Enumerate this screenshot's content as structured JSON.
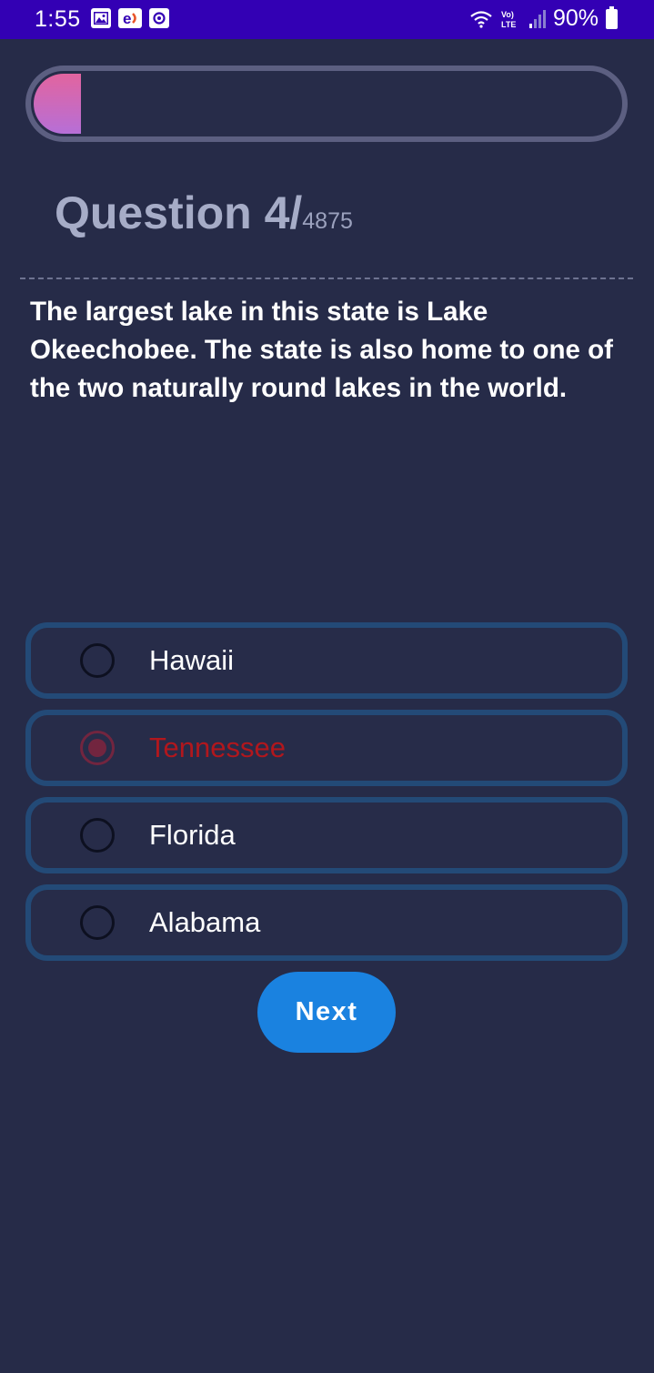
{
  "status_bar": {
    "time": "1:55",
    "battery": "90%",
    "network_label": "Vo) LTE",
    "notification_icons": [
      "gallery-icon",
      "edge-icon",
      "notification-dot-icon"
    ],
    "background": "#3300b4"
  },
  "progress": {
    "fraction": 0.08,
    "gradient": [
      "#e2649f",
      "#b66fd7"
    ]
  },
  "question": {
    "label": "Question 4/",
    "total": "4875",
    "text": "The largest lake in this state is Lake Okeechobee. The state is also home to one of the two naturally round lakes in the world."
  },
  "options": [
    {
      "label": "Hawaii",
      "selected": false
    },
    {
      "label": "Tennessee",
      "selected": true,
      "status": "wrong",
      "status_color": "#b1171d"
    },
    {
      "label": "Florida",
      "selected": false
    },
    {
      "label": "Alabama",
      "selected": false
    }
  ],
  "next_button": {
    "label": "Next",
    "color": "#1a82e0"
  },
  "colors": {
    "background": "#262b48",
    "option_border": "#234a77",
    "progress_border": "#5c5f81"
  }
}
